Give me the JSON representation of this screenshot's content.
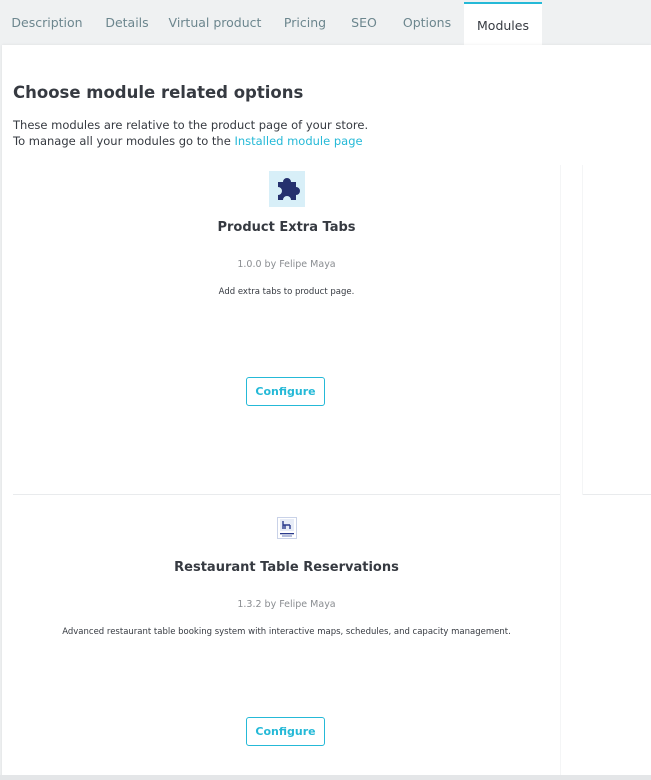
{
  "tabs": [
    {
      "label": "Description"
    },
    {
      "label": "Details"
    },
    {
      "label": "Virtual product"
    },
    {
      "label": "Pricing"
    },
    {
      "label": "SEO"
    },
    {
      "label": "Options"
    },
    {
      "label": "Modules"
    }
  ],
  "active_tab": "Modules",
  "section": {
    "title": "Choose module related options",
    "intro_line1": "These modules are relative to the product page of your store.",
    "intro_line2_prefix": "To manage all your modules go to the ",
    "intro_link": "Installed module page"
  },
  "modules": [
    {
      "icon": "puzzle-icon",
      "name": "Product Extra Tabs",
      "meta": "1.0.0 by Felipe Maya",
      "description": "Add extra tabs to product page.",
      "button": "Configure"
    },
    {
      "icon": "restaurant-logo-icon",
      "name": "Restaurant Table Reservations",
      "meta": "1.3.2 by Felipe Maya",
      "description": "Advanced restaurant table booking system with interactive maps, schedules, and capacity management.",
      "button": "Configure"
    }
  ],
  "colors": {
    "accent": "#25b9d7",
    "text": "#363a41",
    "muted_tab": "#6c868e",
    "icon_bg": "#d8eff8",
    "puzzle": "#25306e"
  }
}
